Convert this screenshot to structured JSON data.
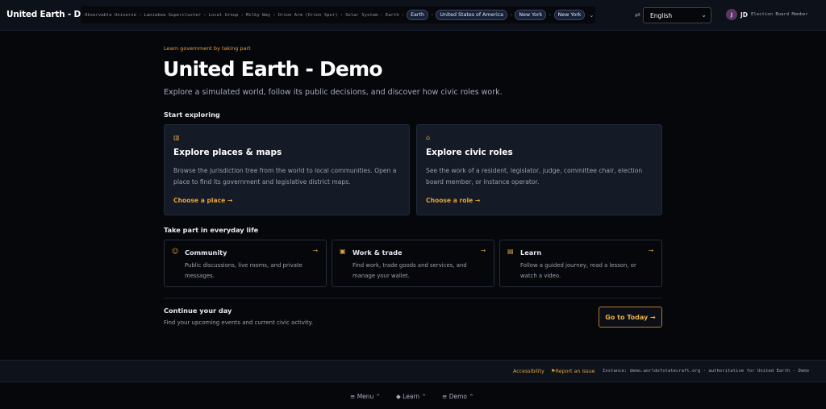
{
  "header": {
    "brand": "United Earth - Demo",
    "breadcrumbs": [
      "Observable Universe",
      "Laniakea Supercluster",
      "Local Group",
      "Milky Way",
      "Orion Arm (Orion Spur)",
      "Solar System",
      "Earth"
    ],
    "separator": "›",
    "pills": [
      "Earth",
      "United States of America",
      "New York",
      "New York"
    ],
    "language": "English",
    "user": {
      "avatar_letter": "J",
      "initials": "JD",
      "role": "Election Board Member"
    }
  },
  "hero": {
    "kicker": "Learn government by taking part",
    "title": "United Earth - Demo",
    "subtitle": "Explore a simulated world, follow its public decisions, and discover how civic roles work."
  },
  "explore": {
    "heading": "Start exploring",
    "cards": [
      {
        "title": "Explore places & maps",
        "desc": "Browse the jurisdiction tree from the world to local communities. Open a place to find its government and legislative district maps.",
        "link": "Choose a place →",
        "icon": "map-icon"
      },
      {
        "title": "Explore civic roles",
        "desc": "See the work of a resident, legislator, judge, committee chair, election board member, or instance operator.",
        "link": "Choose a role →",
        "icon": "institution-icon"
      }
    ]
  },
  "everyday": {
    "heading": "Take part in everyday life",
    "cards": [
      {
        "title": "Community",
        "desc": "Public discussions, live rooms, and private messages.",
        "icon": "users-icon"
      },
      {
        "title": "Work & trade",
        "desc": "Find work, trade goods and services, and manage your wallet.",
        "icon": "briefcase-icon"
      },
      {
        "title": "Learn",
        "desc": "Follow a guided journey, read a lesson, or watch a video.",
        "icon": "book-icon"
      }
    ]
  },
  "continue_section": {
    "title": "Continue your day",
    "desc": "Find your upcoming events and current civic activity.",
    "button": "Go to Today →"
  },
  "footer": {
    "accessibility": "Accessibility",
    "report": "Report an issue",
    "instance": "Instance: demo.worldofstatecraft.org · authoritative for United Earth - Demo"
  },
  "bottom_nav": [
    "Menu",
    "Learn",
    "Demo"
  ],
  "colors": {
    "accent": "#e3a23b",
    "background": "#05070b",
    "card": "#141a26"
  }
}
